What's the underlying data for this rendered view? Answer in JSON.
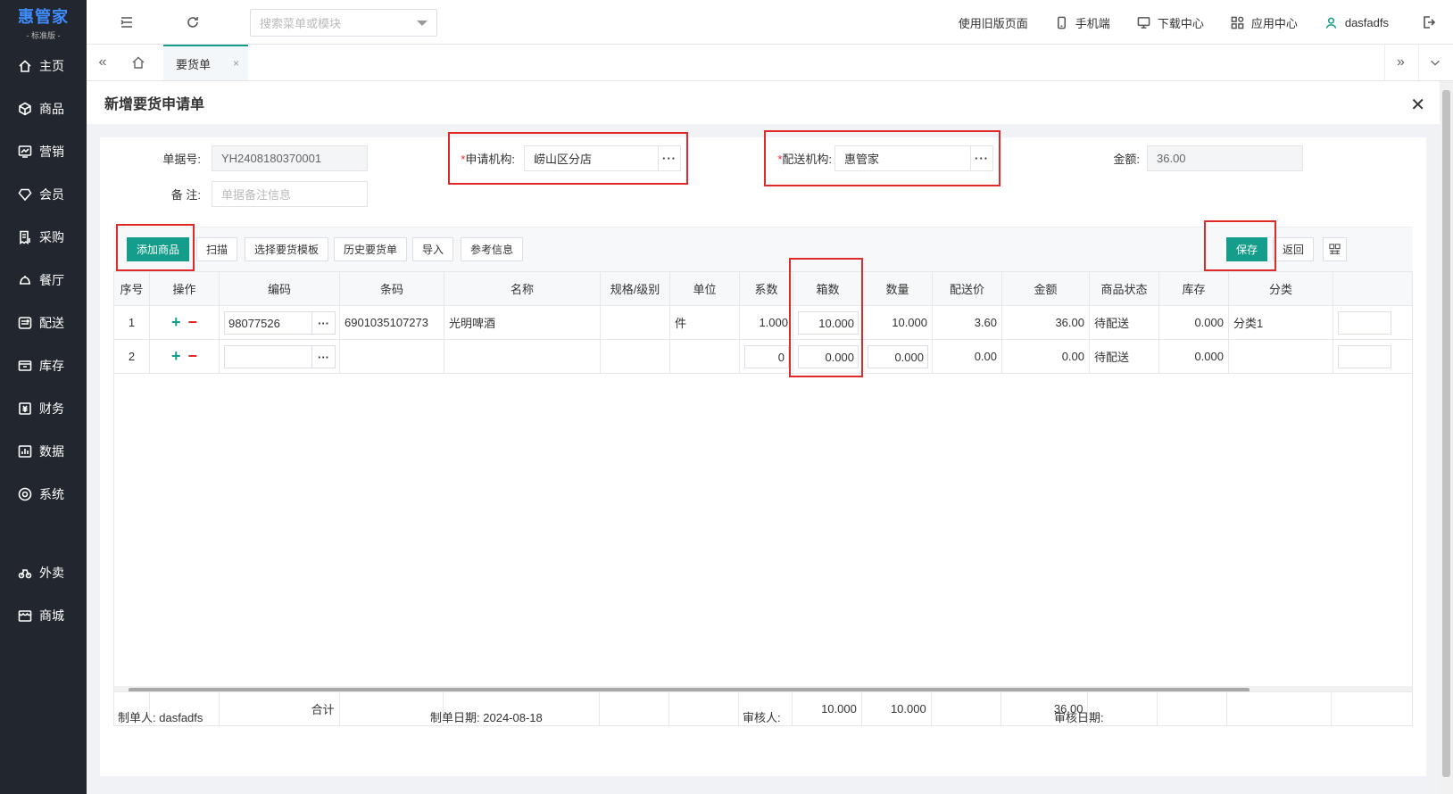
{
  "logo": {
    "main": "惠管家",
    "sub": "- 标准版 -"
  },
  "sidebar": {
    "items": [
      {
        "label": "主页",
        "icon": "home-icon"
      },
      {
        "label": "商品",
        "icon": "cube-icon"
      },
      {
        "label": "营销",
        "icon": "chart-icon"
      },
      {
        "label": "会员",
        "icon": "diamond-icon"
      },
      {
        "label": "采购",
        "icon": "receipt-icon"
      },
      {
        "label": "餐厅",
        "icon": "bell-icon"
      },
      {
        "label": "配送",
        "icon": "truck-icon"
      },
      {
        "label": "库存",
        "icon": "box-icon"
      },
      {
        "label": "财务",
        "icon": "money-icon"
      },
      {
        "label": "数据",
        "icon": "bars-icon"
      },
      {
        "label": "系统",
        "icon": "target-icon"
      }
    ],
    "extra_items": [
      {
        "label": "外卖",
        "icon": "bike-icon"
      },
      {
        "label": "商城",
        "icon": "shop-icon"
      }
    ]
  },
  "topbar": {
    "search_placeholder": "搜索菜单或模块",
    "old_page": "使用旧版页面",
    "mobile": "手机端",
    "download": "下载中心",
    "apps": "应用中心",
    "user": "dasfadfs"
  },
  "tabs": {
    "active": "要货单",
    "close": "×"
  },
  "page": {
    "title": "新增要货申请单",
    "close": "✕"
  },
  "form": {
    "doc_no_label": "单据号:",
    "doc_no": "YH2408180370001",
    "remark_label": "备 注:",
    "remark_placeholder": "单据备注信息",
    "apply_org_label": "申请机构:",
    "apply_org": "崂山区分店",
    "delivery_org_label": "配送机构:",
    "delivery_org": "惠管家",
    "amount_label": "金额:",
    "amount": "36.00",
    "required_mark": "*",
    "dots": "···"
  },
  "toolbar": {
    "add_goods": "添加商品",
    "scan": "扫描",
    "select_template": "选择要货模板",
    "history": "历史要货单",
    "import": "导入",
    "reference": "参考信息",
    "save": "保存",
    "back": "返回"
  },
  "table": {
    "headers": [
      "序号",
      "操作",
      "编码",
      "条码",
      "名称",
      "规格/级别",
      "单位",
      "系数",
      "箱数",
      "数量",
      "配送价",
      "金额",
      "商品状态",
      "库存",
      "分类"
    ],
    "rows": [
      {
        "no": "1",
        "code": "98077526",
        "barcode": "6901035107273",
        "name": "光明啤酒",
        "spec": "",
        "unit": "件",
        "factor": "1.000",
        "boxes": "10.000",
        "qty": "10.000",
        "price": "3.60",
        "amount": "36.00",
        "status": "待配送",
        "stock": "0.000",
        "category": "分类1"
      },
      {
        "no": "2",
        "code": "",
        "barcode": "",
        "name": "",
        "spec": "",
        "unit": "",
        "factor": "0",
        "boxes": "0.000",
        "qty": "0.000",
        "price": "0.00",
        "amount": "0.00",
        "status": "待配送",
        "stock": "0.000",
        "category": ""
      }
    ],
    "summary": {
      "label": "合计",
      "boxes": "10.000",
      "qty": "10.000",
      "amount": "36.00"
    }
  },
  "footer": {
    "creator_label": "制单人:",
    "creator": "dasfadfs",
    "date_label": "制单日期:",
    "date": "2024-08-18",
    "auditor_label": "审核人:",
    "auditor": "",
    "audit_date_label": "审核日期:",
    "audit_date": ""
  },
  "colors": {
    "accent": "#139d8a",
    "highlight": "#e02a2a",
    "sidebar": "#22262e",
    "logo": "#3f8cff"
  }
}
